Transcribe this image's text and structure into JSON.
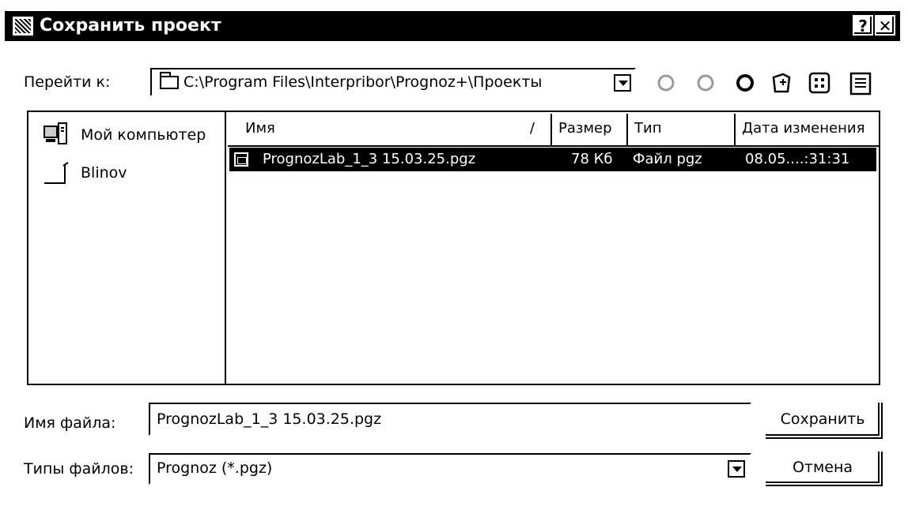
{
  "window": {
    "title": "Сохранить проект",
    "help_label": "?",
    "close_label": "✕"
  },
  "goto": {
    "label": "Перейти к:",
    "path": "C:\\Program Files\\Interpribor\\Prognoz+\\Проекты"
  },
  "toolbar": [
    "back-icon",
    "up-folder-icon",
    "favorites-icon",
    "new-folder-icon",
    "list-view-icon",
    "details-view-icon"
  ],
  "places": [
    {
      "label": "Мой компьютер",
      "icon": "computer-icon"
    },
    {
      "label": "Blinov",
      "icon": "folder-icon"
    }
  ],
  "file_list": {
    "columns": [
      "Имя",
      "Размер",
      "Тип",
      "Дата изменения"
    ],
    "rows": [
      {
        "name": "PrognozLab_1_3 15.03.25.pgz",
        "size": "78 Кб",
        "type": "Файл pgz",
        "date": "08.05....:31:31"
      }
    ]
  },
  "filename": {
    "label": "Имя файла:",
    "value": "PrognozLab_1_3 15.03.25.pgz"
  },
  "filetype": {
    "label": "Типы файлов:",
    "value": "Prognoz (*.pgz)"
  },
  "buttons": {
    "save": "Сохранить",
    "cancel": "Отмена"
  }
}
